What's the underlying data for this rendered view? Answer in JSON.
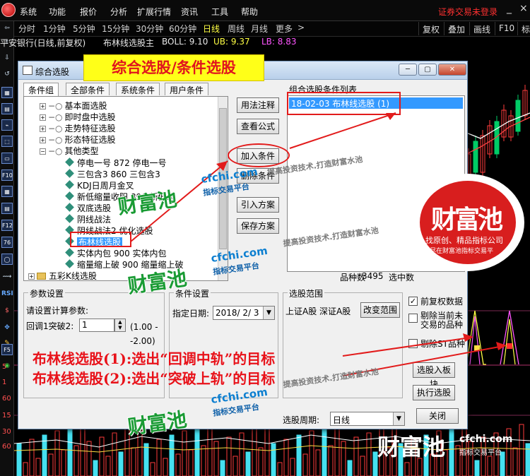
{
  "menu": {
    "items": [
      "系统",
      "功能",
      "报价",
      "分析",
      "扩展行情",
      "资讯",
      "工具",
      "帮助"
    ],
    "login_status": "证券交易未登录",
    "min_label": "_",
    "close_label": "×"
  },
  "periods": {
    "items": [
      "分时",
      "1分钟",
      "5分钟",
      "15分钟",
      "30分钟",
      "60分钟",
      "日线",
      "周线",
      "月线",
      "更多"
    ],
    "active": "日线",
    "more_arrow": ">",
    "right_buttons": [
      "复权",
      "叠加",
      "画线",
      "F10",
      "标"
    ]
  },
  "stock_title": {
    "name": "平安银行(日线,前复权)",
    "indicator": "布林线选股主",
    "boll": "BOLL: 9.10",
    "ub": "UB: 9.37",
    "lb": "LB: 8.83"
  },
  "left_toolbar": {
    "icons": [
      "⇦",
      "⇧",
      "⇩",
      "↺",
      "▦",
      "▤",
      "⌁",
      "⬚",
      "▭",
      "F10",
      "▦",
      "▤",
      "F12",
      "76",
      "◯",
      "⟿",
      "RSI",
      "$",
      "✥",
      "✎",
      "F5",
      "◉"
    ],
    "axis_labels": [
      "5",
      "1",
      "60",
      "15",
      "30",
      "60"
    ]
  },
  "dialog": {
    "title": "综合选股",
    "min_label": "─",
    "max_label": "▢",
    "close_label": "✕",
    "tabs": [
      "条件组",
      "全部条件",
      "系统条件",
      "用户条件"
    ],
    "tree": [
      {
        "label": "基本面选股",
        "type": "group"
      },
      {
        "label": "即时盘中选股",
        "type": "group"
      },
      {
        "label": "走势特征选股",
        "type": "group"
      },
      {
        "label": "形态特征选股",
        "type": "group"
      },
      {
        "label": "其他类型",
        "type": "open"
      },
      {
        "label": "停电一号  872  停电一号",
        "type": "leaf"
      },
      {
        "label": "三包含3  860  三包含3",
        "type": "leaf"
      },
      {
        "label": "KDJ日周月金叉",
        "type": "leaf"
      },
      {
        "label": "新低缩量收阳  896  新低缩",
        "type": "leaf"
      },
      {
        "label": "双底选股",
        "type": "leaf"
      },
      {
        "label": "阴线战法",
        "type": "leaf"
      },
      {
        "label": "阴线战法2  优化选股",
        "type": "leaf"
      },
      {
        "label": "布林线选股",
        "type": "selected"
      },
      {
        "label": "实体内包  900  实体内包",
        "type": "leaf"
      },
      {
        "label": "缩量缩上破  900  缩量缩上破",
        "type": "leaf"
      },
      {
        "label": "五彩K线选股",
        "type": "folder"
      }
    ],
    "tree_expand_plus": "+",
    "tree_expand_minus": "−",
    "tree_link_glyph": "−○",
    "buttons": {
      "usage": "用法注释",
      "view_formula": "查看公式",
      "add": "加入条件",
      "delete": "删除条件",
      "load": "引入方案",
      "save": "保存方案",
      "to_block": "选股入板块",
      "run": "执行选股",
      "close": "关闭"
    },
    "cond_list_label": "组合选股条件列表",
    "cond_items": [
      "18-02-03  布林线选股  (1)"
    ],
    "count_label": "品种数",
    "count_value": "3495",
    "selected_label": "选中数",
    "params": {
      "title": "参数设置",
      "prompt": "请设置计算参数:",
      "name": "回调1突破2:",
      "value": "1",
      "range": "(1.00   --2.00)",
      "spin_up": "▲",
      "spin_down": "▼"
    },
    "condition_settings": {
      "title": "条件设置",
      "date_label": "指定日期:",
      "date_value": "2018/ 2/ 3",
      "arrow": "▼"
    },
    "range_settings": {
      "title": "选股范围",
      "values": "上证A股 深证A股",
      "change_button": "改变范围",
      "options": [
        {
          "label": "前复权数据",
          "checked": true
        },
        {
          "label": "剔除当前未交易的品种",
          "checked": false
        },
        {
          "label": "剔除ST品种",
          "checked": false
        }
      ],
      "check_mark": "✓"
    },
    "period_label": "选股周期:",
    "period_value": "日线"
  },
  "banner": "综合选股/条件选股",
  "annotations": {
    "line1": "布林线选股(1):选出“回调中轨”的目标",
    "line2": "布林线选股(2):选出“突破上轨”的目标"
  },
  "watermark": {
    "cn": "财富池",
    "url": "cfchi.com",
    "sub": "指标交易平台",
    "slogan": "提高投资技术.打造财富水池"
  },
  "stamp": {
    "text": "财富池",
    "sub": "找原创、精品指标公司",
    "sub2": "尽在财富池指标交易平"
  },
  "colors": {
    "accent_red": "#e21b1b",
    "banner_yellow": "#ffff18",
    "watermark_green": "#1a9b34",
    "watermark_blue": "#0d7fd0",
    "selection_blue": "#3399ff",
    "volume_cyan": "#45e0f0"
  }
}
